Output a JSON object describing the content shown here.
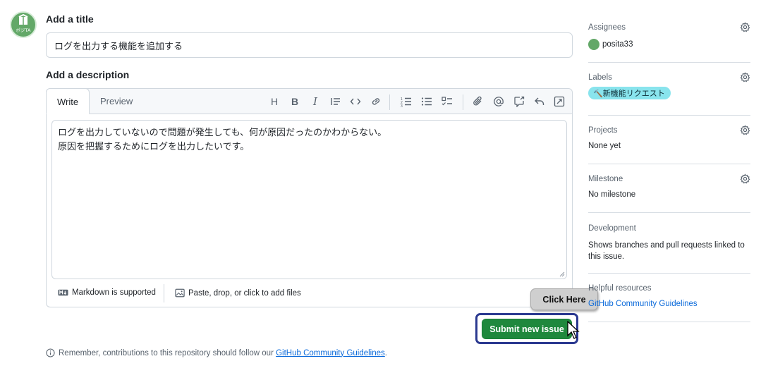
{
  "user": {
    "avatar_text": "ポジTA"
  },
  "title_section": {
    "heading": "Add a title",
    "value": "ログを出力する機能を追加する"
  },
  "description_section": {
    "heading": "Add a description",
    "tabs": [
      "Write",
      "Preview"
    ],
    "toolbar_icons": [
      "heading-icon",
      "bold-icon",
      "italic-icon",
      "quote-icon",
      "code-icon",
      "link-icon",
      "numbered-list-icon",
      "bulleted-list-icon",
      "task-list-icon",
      "attach-icon",
      "mention-icon",
      "reference-icon",
      "undo-icon",
      "fullscreen-icon"
    ],
    "body_line1": "ログを出力していないので問題が発生しても、何が原因だったのかわからない。",
    "body_line2": "原因を把握するためにログを出力したいです。",
    "markdown_label": "Markdown is supported",
    "paste_label": "Paste, drop, or click to add files"
  },
  "actions": {
    "submit_label": "Submit new issue",
    "callout_label": "Click Here"
  },
  "footer": {
    "remember_text": "Remember, contributions to this repository should follow our",
    "guidelines_link": "GitHub Community Guidelines",
    "period": "."
  },
  "sidebar": {
    "assignees": {
      "heading": "Assignees",
      "user": "posita33"
    },
    "labels": {
      "heading": "Labels",
      "label": "🔨新機能リクエスト",
      "label_color": "#89e4ed"
    },
    "projects": {
      "heading": "Projects",
      "value": "None yet"
    },
    "milestone": {
      "heading": "Milestone",
      "value": "No milestone"
    },
    "development": {
      "heading": "Development",
      "value": "Shows branches and pull requests linked to this issue."
    },
    "helpful": {
      "heading": "Helpful resources",
      "link": "GitHub Community Guidelines"
    }
  },
  "colors": {
    "primary_green": "#1f883d",
    "link_blue": "#0969da",
    "highlight_border": "#2b3990"
  }
}
